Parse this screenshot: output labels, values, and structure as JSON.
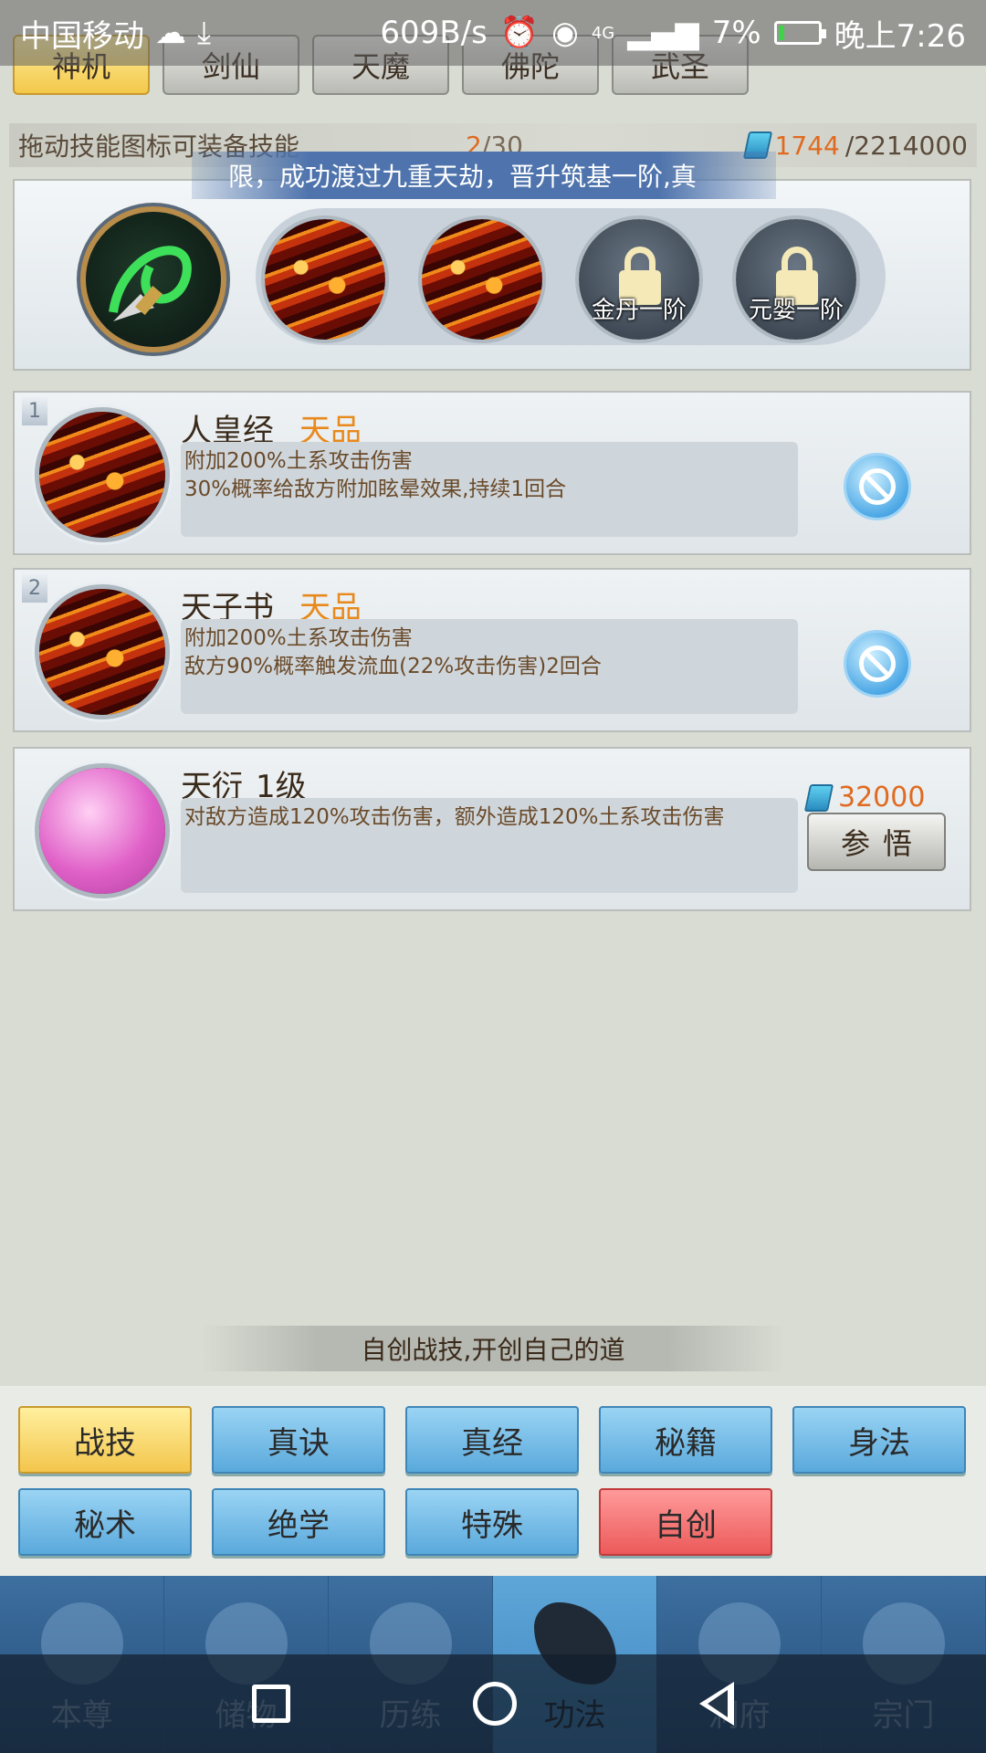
{
  "status_bar": {
    "carrier": "中国移动",
    "speed": "609B/s",
    "signal": "4G",
    "battery": "7%",
    "time": "晚上7:26"
  },
  "class_tabs": [
    "神机",
    "剑仙",
    "天魔",
    "佛陀",
    "武圣"
  ],
  "info": {
    "hint": "拖动技能图标可装备技能",
    "slots_used": "2",
    "slots_total": "/30",
    "currency_have": "1744",
    "currency_total": "/2214000"
  },
  "marquee": "限，成功渡过九重天劫，晋升筑基一阶,真",
  "locked_slots": [
    "金丹一阶",
    "元婴一阶"
  ],
  "skills": [
    {
      "rank": "1",
      "name": "人皇经",
      "grade": "天品",
      "desc1": "附加200%土系攻击伤害",
      "desc2": "30%概率给敌方附加眩晕效果,持续1回合"
    },
    {
      "rank": "2",
      "name": "天子书",
      "grade": "天品",
      "desc1": "附加200%土系攻击伤害",
      "desc2": "敌方90%概率触发流血(22%攻击伤害)2回合"
    },
    {
      "name": "天衍",
      "grade": "1级",
      "desc1": "对敌方造成120%攻击伤害，额外造成120%土系攻击伤害",
      "cost": "32000",
      "button": "参悟"
    }
  ],
  "create_banner": "自创战技,开创自己的道",
  "categories": [
    "战技",
    "真诀",
    "真经",
    "秘籍",
    "身法",
    "秘术",
    "绝学",
    "特殊",
    "自创"
  ],
  "bottom_nav": [
    "本尊",
    "储物",
    "历练",
    "功法",
    "洞府",
    "宗门"
  ],
  "colors": {
    "accent_orange": "#e06a20",
    "grade_gold": "#e8891c",
    "active_tab": "#f3c84a",
    "category_blue": "#5aa9dc",
    "category_red": "#ec5a5a",
    "nav_bg": "#244d78"
  }
}
